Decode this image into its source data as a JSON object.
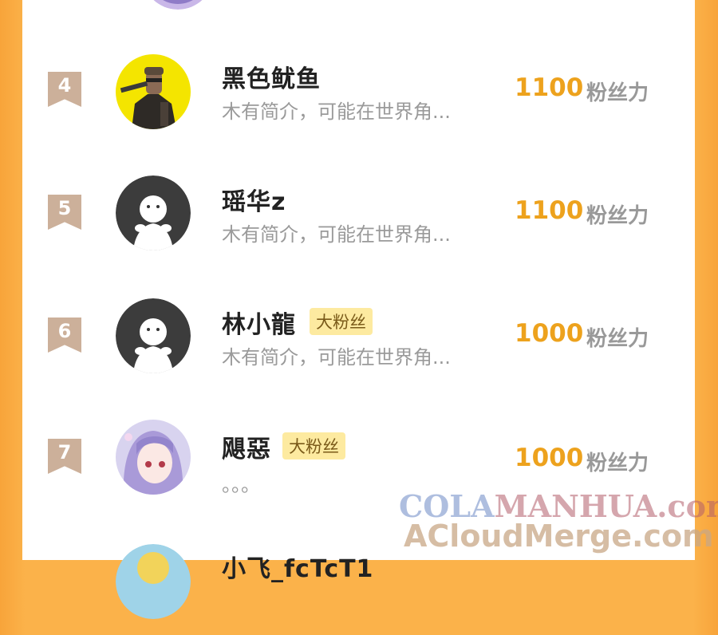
{
  "leaderboard": {
    "unit": "粉丝力",
    "rows": [
      {
        "rank": "4",
        "name": "黑色鱿鱼",
        "badge": "",
        "intro": "木有简介，可能在世界角...",
        "score": "1100",
        "avatar": "cyberpunk-character-avatar"
      },
      {
        "rank": "5",
        "name": "瑶华z",
        "badge": "",
        "intro": "木有简介，可能在世界角...",
        "score": "1100",
        "avatar": "default-avatar"
      },
      {
        "rank": "6",
        "name": "林小龍",
        "badge": "大粉丝",
        "intro": "木有简介，可能在世界角...",
        "score": "1000",
        "avatar": "default-avatar"
      },
      {
        "rank": "7",
        "name": "飓惡",
        "badge": "大粉丝",
        "intro": "。。。",
        "score": "1000",
        "avatar": "anime-girl-avatar"
      }
    ],
    "partial_next_name": "小飞_fcTcT1"
  },
  "watermark": {
    "line1_a": "COLA",
    "line1_b": "MANHUA",
    "line1_c": ".com",
    "line2": "ACloudMerge.com"
  },
  "colors": {
    "background": "#fbb24a",
    "score": "#eda21d",
    "rank_ribbon": "#ccb09a",
    "badge_bg": "#fdeaa0"
  }
}
